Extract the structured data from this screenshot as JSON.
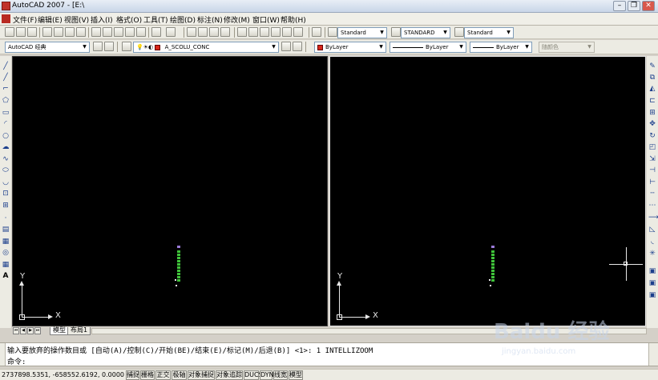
{
  "window": {
    "title": "AutoCAD 2007 - [E:\\",
    "minimize": "–",
    "restore": "❐",
    "close": "✕"
  },
  "menu": [
    "文件(F)",
    "编辑(E)",
    "视图(V)",
    "插入(I)",
    "格式(O)",
    "工具(T)",
    "绘图(D)",
    "标注(N)",
    "修改(M)",
    "窗口(W)",
    "帮助(H)"
  ],
  "toolbar_styles": {
    "text_style": "Standard",
    "dim_style": "STANDARD",
    "table_style": "Standard"
  },
  "toolbar_props": {
    "workspace": "AutoCAD 经典",
    "layer": "A_SCOLU_CONC",
    "color": "ByLayer",
    "linetype": "ByLayer",
    "lineweight": "ByLayer",
    "plotstyle": "随颜色"
  },
  "colors": {
    "layer_color": "#d8281c",
    "drawing_green": "#3fc23a",
    "drawing_purple": "#9a7ad8",
    "canvas": "#000000"
  },
  "viewports": {
    "left": {
      "axis_y": "Y",
      "axis_x": "X"
    },
    "right": {
      "axis_y": "Y",
      "axis_x": "X"
    }
  },
  "layout_tabs": {
    "model": "模型",
    "layout1": "布局1"
  },
  "command": {
    "history": "输入要放弃的操作数目或 [自动(A)/控制(C)/开始(BE)/结束(E)/标记(M)/后退(B)] <1>: 1 INTELLIZOOM",
    "prompt": "命令:"
  },
  "status": {
    "coordinates": "2737898.5351, -658552.6192, 0.0000",
    "buttons": [
      "捕捉",
      "栅格",
      "正交",
      "极轴",
      "对象捕捉",
      "对象追踪",
      "DUCS",
      "DYN",
      "线宽",
      "模型"
    ]
  },
  "watermark": {
    "brand": "Baidu 经验",
    "url": "jingyan.baidu.com"
  }
}
